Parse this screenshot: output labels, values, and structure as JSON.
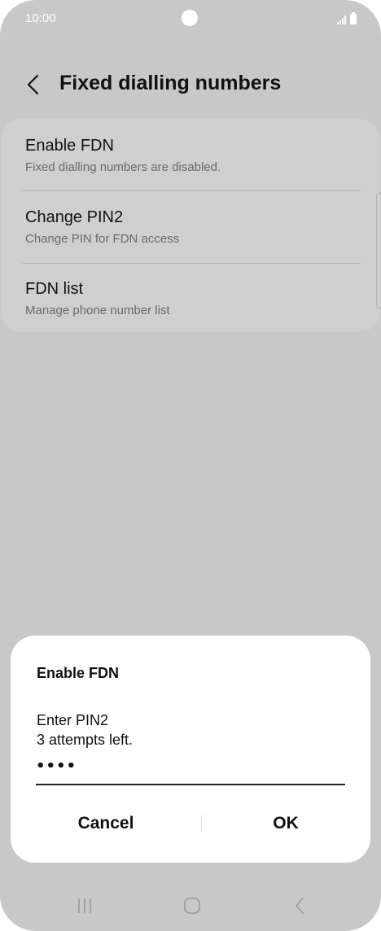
{
  "status_bar": {
    "time": "10:00",
    "signal_icon": "signal-icon",
    "battery_icon": "battery-icon"
  },
  "header": {
    "back_icon": "chevron-left-icon",
    "title": "Fixed dialling numbers"
  },
  "settings": {
    "items": [
      {
        "title": "Enable FDN",
        "subtitle": "Fixed dialling numbers are disabled."
      },
      {
        "title": "Change PIN2",
        "subtitle": "Change PIN for FDN access"
      },
      {
        "title": "FDN list",
        "subtitle": "Manage phone number list"
      }
    ]
  },
  "dialog": {
    "title": "Enable FDN",
    "prompt": "Enter PIN2",
    "attempts": "3 attempts left.",
    "pin_value": "1234",
    "cancel_label": "Cancel",
    "ok_label": "OK"
  },
  "nav_bar": {
    "recents_icon": "recents-icon",
    "home_icon": "home-icon",
    "back_icon": "back-icon"
  },
  "colors": {
    "dimmed_background": "#c8c8c8",
    "card_background": "#cfcfcf",
    "dialog_background": "#ffffff",
    "text_primary": "#111111",
    "text_secondary": "#6a6a6a"
  }
}
